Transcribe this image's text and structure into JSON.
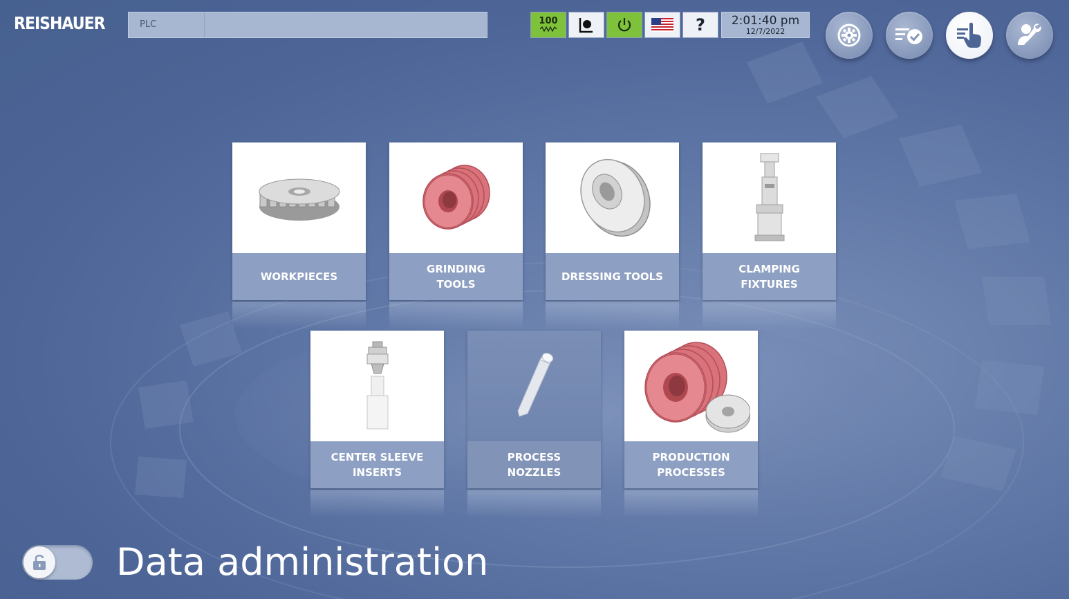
{
  "app": {
    "brand": "REISHAUER"
  },
  "top_bar": {
    "plc_label": "PLC",
    "speed_value": "100",
    "speed_unit_symbol": "wave-icon",
    "help_label": "?",
    "clock_time": "2:01:40 pm",
    "clock_date": "12/7/2022",
    "status_colors": {
      "speed_ok": "#7dc23a",
      "power_ok": "#7dc23a"
    }
  },
  "nav_buttons": [
    {
      "icon": "settings-gear-icon",
      "active": false
    },
    {
      "icon": "checklist-icon",
      "active": false
    },
    {
      "icon": "data-touch-icon",
      "active": true
    },
    {
      "icon": "service-wrench-icon",
      "active": false
    }
  ],
  "tiles": [
    {
      "label": "WORKPIECES",
      "icon": "gear-workpiece-icon",
      "dim": false
    },
    {
      "label": "GRINDING\nTOOLS",
      "icon": "grinding-worm-icon",
      "dim": false
    },
    {
      "label": "DRESSING TOOLS",
      "icon": "dressing-disc-icon",
      "dim": false
    },
    {
      "label": "CLAMPING\nFIXTURES",
      "icon": "clamping-fixture-icon",
      "dim": false
    },
    {
      "label": "CENTER SLEEVE\nINSERTS",
      "icon": "center-sleeve-icon",
      "dim": false
    },
    {
      "label": "PROCESS\nNOZZLES",
      "icon": "nozzle-icon",
      "dim": true
    },
    {
      "label": "PRODUCTION\nPROCESSES",
      "icon": "production-process-icon",
      "dim": false
    }
  ],
  "footer": {
    "lock_icon": "unlock-icon",
    "page_title": "Data administration"
  },
  "colors": {
    "background": "#5f77a6",
    "tile_label_bg": "#8d9fc2",
    "grinding_red": "#d96a72"
  }
}
